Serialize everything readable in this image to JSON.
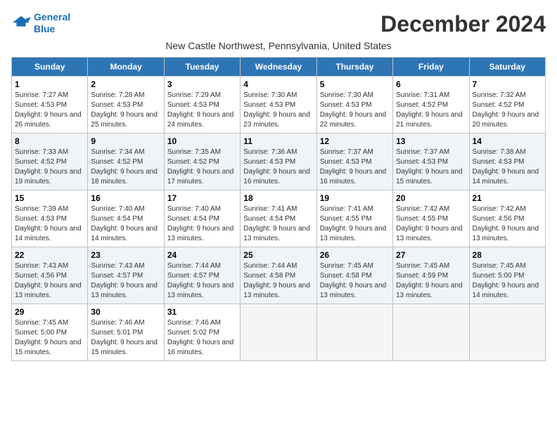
{
  "header": {
    "logo_line1": "General",
    "logo_line2": "Blue",
    "month_year": "December 2024",
    "location": "New Castle Northwest, Pennsylvania, United States"
  },
  "weekdays": [
    "Sunday",
    "Monday",
    "Tuesday",
    "Wednesday",
    "Thursday",
    "Friday",
    "Saturday"
  ],
  "weeks": [
    [
      {
        "day": "1",
        "sunrise": "7:27 AM",
        "sunset": "4:53 PM",
        "daylight": "9 hours and 26 minutes."
      },
      {
        "day": "2",
        "sunrise": "7:28 AM",
        "sunset": "4:53 PM",
        "daylight": "9 hours and 25 minutes."
      },
      {
        "day": "3",
        "sunrise": "7:29 AM",
        "sunset": "4:53 PM",
        "daylight": "9 hours and 24 minutes."
      },
      {
        "day": "4",
        "sunrise": "7:30 AM",
        "sunset": "4:53 PM",
        "daylight": "9 hours and 23 minutes."
      },
      {
        "day": "5",
        "sunrise": "7:30 AM",
        "sunset": "4:53 PM",
        "daylight": "9 hours and 22 minutes."
      },
      {
        "day": "6",
        "sunrise": "7:31 AM",
        "sunset": "4:52 PM",
        "daylight": "9 hours and 21 minutes."
      },
      {
        "day": "7",
        "sunrise": "7:32 AM",
        "sunset": "4:52 PM",
        "daylight": "9 hours and 20 minutes."
      }
    ],
    [
      {
        "day": "8",
        "sunrise": "7:33 AM",
        "sunset": "4:52 PM",
        "daylight": "9 hours and 19 minutes."
      },
      {
        "day": "9",
        "sunrise": "7:34 AM",
        "sunset": "4:52 PM",
        "daylight": "9 hours and 18 minutes."
      },
      {
        "day": "10",
        "sunrise": "7:35 AM",
        "sunset": "4:52 PM",
        "daylight": "9 hours and 17 minutes."
      },
      {
        "day": "11",
        "sunrise": "7:36 AM",
        "sunset": "4:53 PM",
        "daylight": "9 hours and 16 minutes."
      },
      {
        "day": "12",
        "sunrise": "7:37 AM",
        "sunset": "4:53 PM",
        "daylight": "9 hours and 16 minutes."
      },
      {
        "day": "13",
        "sunrise": "7:37 AM",
        "sunset": "4:53 PM",
        "daylight": "9 hours and 15 minutes."
      },
      {
        "day": "14",
        "sunrise": "7:38 AM",
        "sunset": "4:53 PM",
        "daylight": "9 hours and 14 minutes."
      }
    ],
    [
      {
        "day": "15",
        "sunrise": "7:39 AM",
        "sunset": "4:53 PM",
        "daylight": "9 hours and 14 minutes."
      },
      {
        "day": "16",
        "sunrise": "7:40 AM",
        "sunset": "4:54 PM",
        "daylight": "9 hours and 14 minutes."
      },
      {
        "day": "17",
        "sunrise": "7:40 AM",
        "sunset": "4:54 PM",
        "daylight": "9 hours and 13 minutes."
      },
      {
        "day": "18",
        "sunrise": "7:41 AM",
        "sunset": "4:54 PM",
        "daylight": "9 hours and 13 minutes."
      },
      {
        "day": "19",
        "sunrise": "7:41 AM",
        "sunset": "4:55 PM",
        "daylight": "9 hours and 13 minutes."
      },
      {
        "day": "20",
        "sunrise": "7:42 AM",
        "sunset": "4:55 PM",
        "daylight": "9 hours and 13 minutes."
      },
      {
        "day": "21",
        "sunrise": "7:42 AM",
        "sunset": "4:56 PM",
        "daylight": "9 hours and 13 minutes."
      }
    ],
    [
      {
        "day": "22",
        "sunrise": "7:43 AM",
        "sunset": "4:56 PM",
        "daylight": "9 hours and 13 minutes."
      },
      {
        "day": "23",
        "sunrise": "7:43 AM",
        "sunset": "4:57 PM",
        "daylight": "9 hours and 13 minutes."
      },
      {
        "day": "24",
        "sunrise": "7:44 AM",
        "sunset": "4:57 PM",
        "daylight": "9 hours and 13 minutes."
      },
      {
        "day": "25",
        "sunrise": "7:44 AM",
        "sunset": "4:58 PM",
        "daylight": "9 hours and 13 minutes."
      },
      {
        "day": "26",
        "sunrise": "7:45 AM",
        "sunset": "4:58 PM",
        "daylight": "9 hours and 13 minutes."
      },
      {
        "day": "27",
        "sunrise": "7:45 AM",
        "sunset": "4:59 PM",
        "daylight": "9 hours and 13 minutes."
      },
      {
        "day": "28",
        "sunrise": "7:45 AM",
        "sunset": "5:00 PM",
        "daylight": "9 hours and 14 minutes."
      }
    ],
    [
      {
        "day": "29",
        "sunrise": "7:45 AM",
        "sunset": "5:00 PM",
        "daylight": "9 hours and 15 minutes."
      },
      {
        "day": "30",
        "sunrise": "7:46 AM",
        "sunset": "5:01 PM",
        "daylight": "9 hours and 15 minutes."
      },
      {
        "day": "31",
        "sunrise": "7:46 AM",
        "sunset": "5:02 PM",
        "daylight": "9 hours and 16 minutes."
      },
      null,
      null,
      null,
      null
    ]
  ],
  "labels": {
    "sunrise": "Sunrise:",
    "sunset": "Sunset:",
    "daylight": "Daylight:"
  }
}
